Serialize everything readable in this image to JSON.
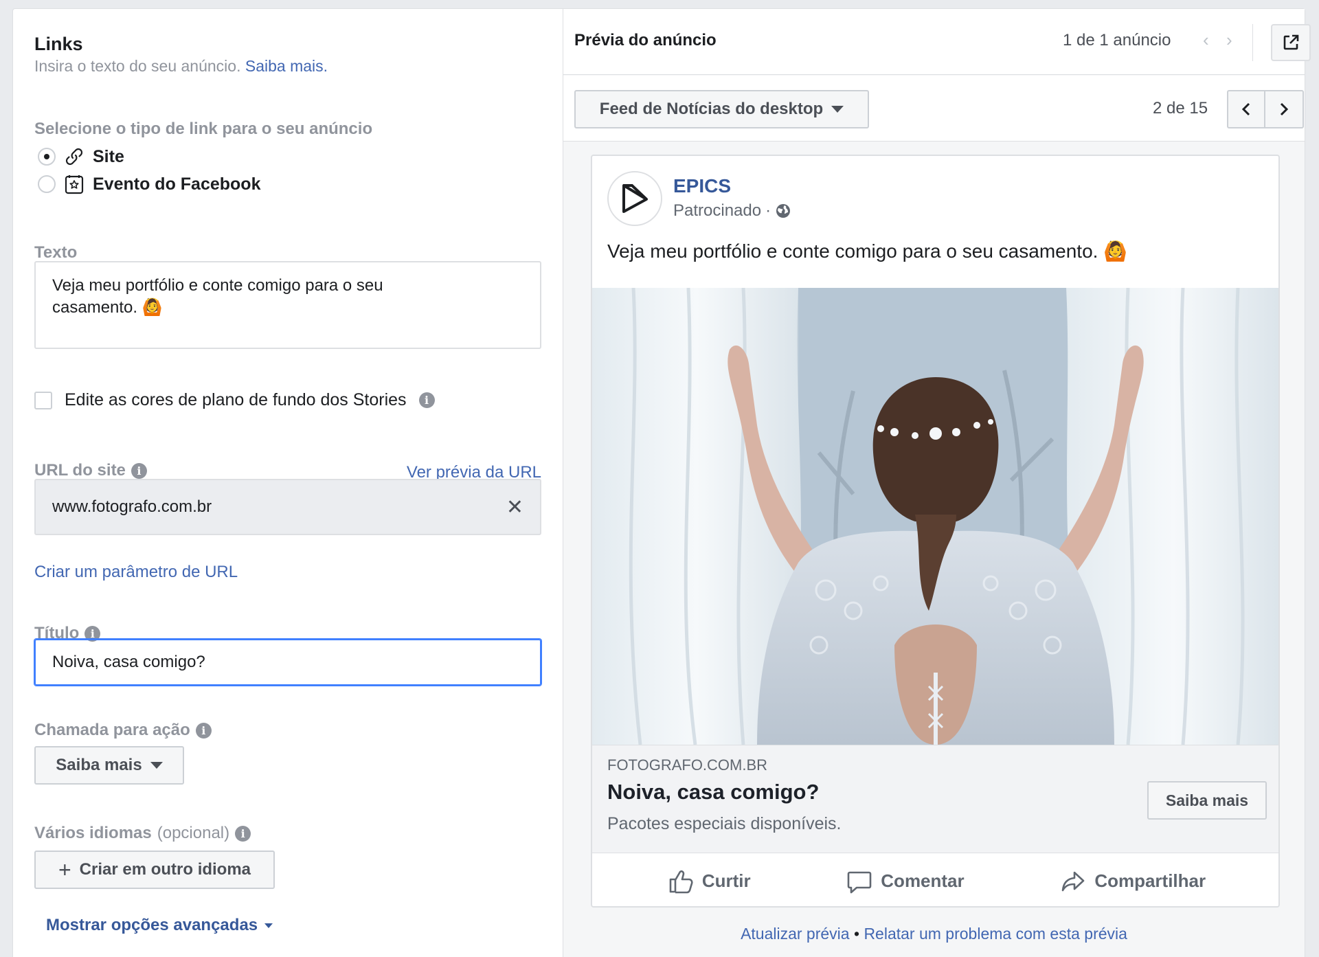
{
  "links": {
    "title": "Links",
    "subtitle": "Insira o texto do seu anúncio.",
    "subtitle_link": "Saiba mais."
  },
  "link_type": {
    "label": "Selecione o tipo de link para o seu anúncio",
    "options": [
      {
        "label": "Site",
        "selected": true,
        "icon": "link-icon"
      },
      {
        "label": "Evento do Facebook",
        "selected": false,
        "icon": "event-star-icon"
      }
    ]
  },
  "text_section": {
    "label": "Texto",
    "value_line1": "Veja meu portfólio e conte comigo para o seu",
    "value_line2": "casamento. 🙆"
  },
  "stories": {
    "checkbox_label": "Edite as cores de plano de fundo dos Stories",
    "checked": false
  },
  "url": {
    "label": "URL do site",
    "preview_link": "Ver prévia da URL",
    "value": "www.fotografo.com.br",
    "param_link": "Criar um parâmetro de URL"
  },
  "title_field": {
    "label": "Título",
    "value": "Noiva, casa comigo?"
  },
  "cta_field": {
    "label": "Chamada para ação",
    "value": "Saiba mais"
  },
  "languages": {
    "label": "Vários idiomas",
    "optional": "(opcional)",
    "button": "Criar em outro idioma"
  },
  "advanced": {
    "label": "Mostrar opções avançadas"
  },
  "preview": {
    "title": "Prévia do anúncio",
    "count": "1 de 1 anúncio",
    "placement": "Feed de Notícias do desktop",
    "page_count": "2 de 15"
  },
  "ad": {
    "page_name": "EPICS",
    "sponsored": "Patrocinado",
    "post_text": "Veja meu portfólio e conte comigo para o seu casamento. 🙆",
    "domain": "FOTOGRAFO.COM.BR",
    "headline": "Noiva, casa comigo?",
    "description": "Pacotes especiais disponíveis.",
    "cta": "Saiba mais",
    "actions": {
      "like": "Curtir",
      "comment": "Comentar",
      "share": "Compartilhar"
    }
  },
  "footer": {
    "update": "Atualizar prévia",
    "separator": "•",
    "report": "Relatar um problema com esta prévia"
  },
  "colors": {
    "link_blue": "#4267b2",
    "focus_blue": "#4080ff",
    "page_name_blue": "#365899"
  }
}
